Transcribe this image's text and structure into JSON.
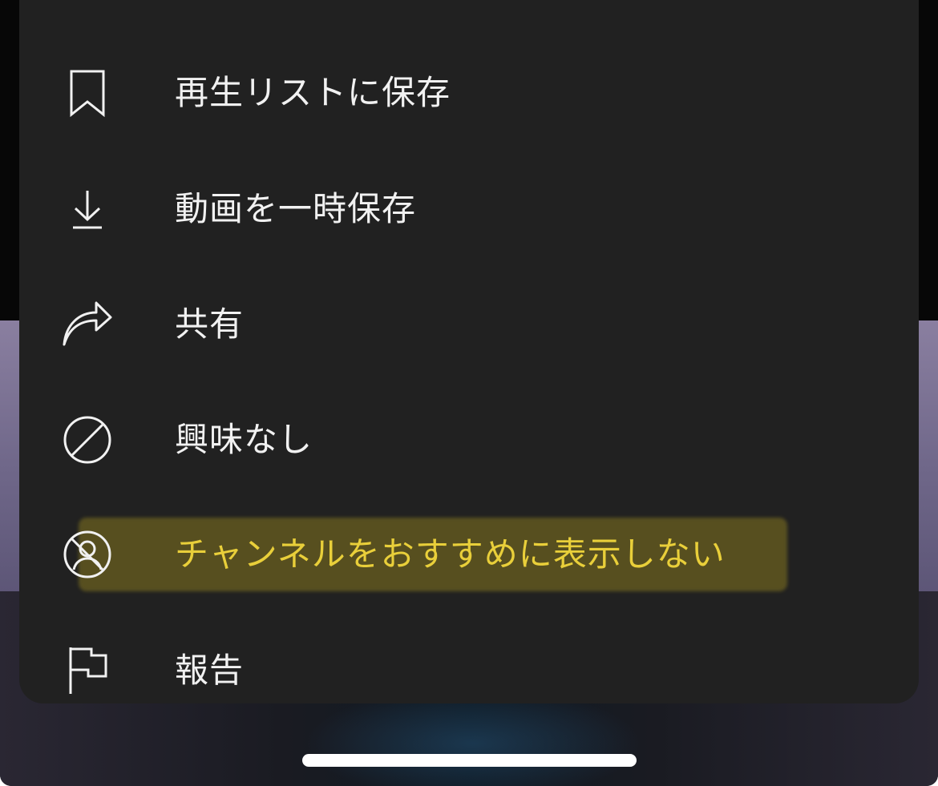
{
  "menu": {
    "items": [
      {
        "label": "再生リストに保存",
        "icon": "bookmark-icon"
      },
      {
        "label": "動画を一時保存",
        "icon": "download-icon"
      },
      {
        "label": "共有",
        "icon": "share-icon"
      },
      {
        "label": "興味なし",
        "icon": "not-interested-icon"
      },
      {
        "label": "チャンネルをおすすめに表示しない",
        "icon": "dont-recommend-channel-icon",
        "highlighted": true
      },
      {
        "label": "報告",
        "icon": "flag-icon"
      }
    ]
  },
  "colors": {
    "sheet_background": "#212121",
    "text": "#f1f1f1",
    "highlight_text": "#e9cf3a"
  }
}
